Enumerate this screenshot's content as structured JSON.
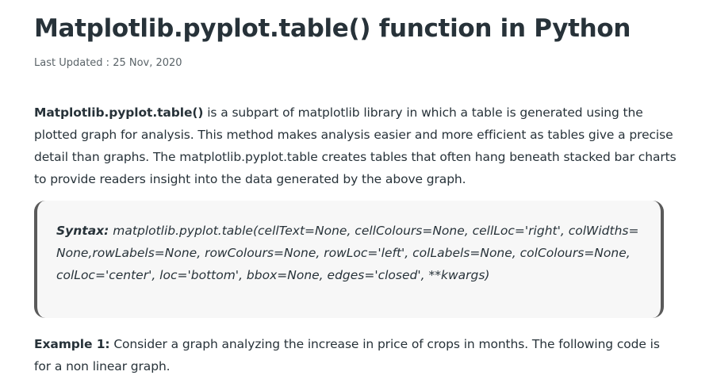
{
  "article": {
    "title": "Matplotlib.pyplot.table() function in Python",
    "last_updated": "Last Updated : 25 Nov, 2020",
    "intro_bold": "Matplotlib.pyplot.table()",
    "intro_rest": " is a subpart of matplotlib library in which a table is generated using the plotted graph for analysis. This method makes analysis easier and more efficient as tables give a precise detail than graphs. The matplotlib.pyplot.table creates tables that often hang beneath stacked bar charts to provide readers insight into the data generated by the above graph.",
    "syntax_label": "Syntax:",
    "syntax_text": " matplotlib.pyplot.table(cellText=None, cellColours=None, cellLoc='right', colWidths=None,rowLabels=None, rowColours=None, rowLoc='left', colLabels=None, colColours=None, colLoc='center', loc='bottom', bbox=None, edges='closed', **kwargs)",
    "example_label": "Example 1:",
    "example_text": " Consider a graph analyzing the increase in price of crops in months. The following code is for a non linear graph."
  }
}
